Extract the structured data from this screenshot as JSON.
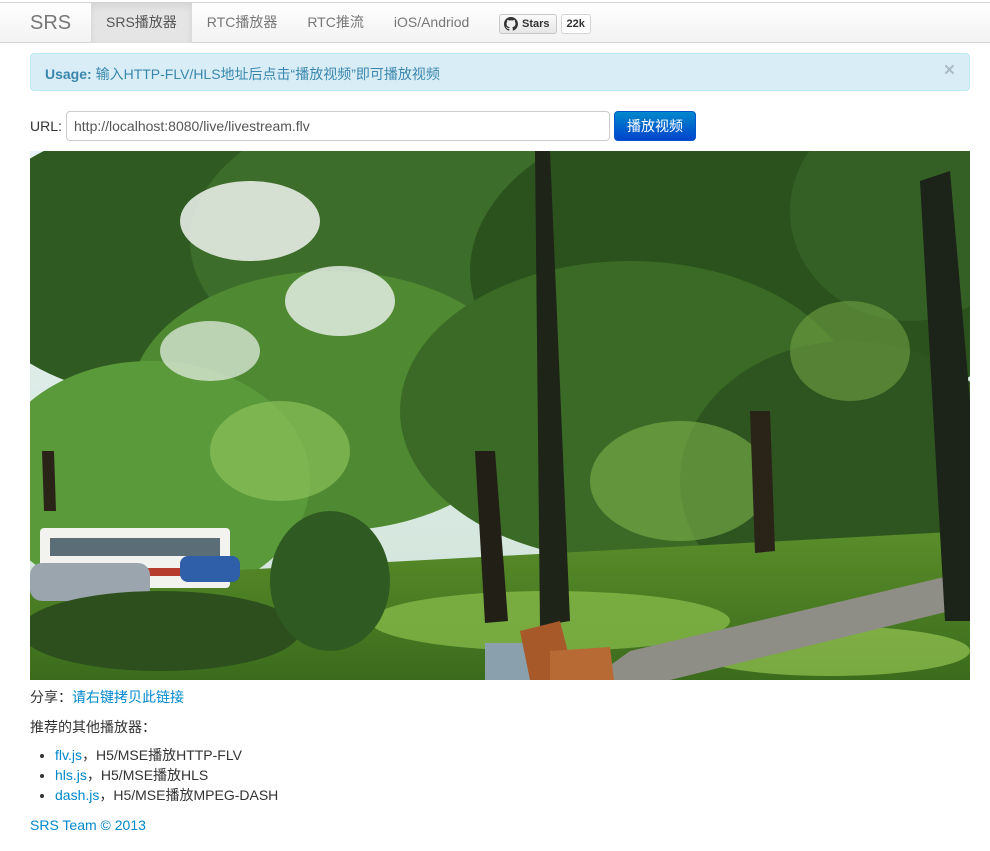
{
  "navbar": {
    "brand": "SRS",
    "items": [
      {
        "label": "SRS播放器",
        "active": true
      },
      {
        "label": "RTC播放器",
        "active": false
      },
      {
        "label": "RTC推流",
        "active": false
      },
      {
        "label": "iOS/Andriod",
        "active": false
      }
    ],
    "github": {
      "label": "Stars",
      "count": "22k",
      "icon": "github-icon"
    }
  },
  "alert": {
    "strong": "Usage:",
    "text": "输入HTTP-FLV/HLS地址后点击“播放视频”即可播放视频",
    "close": "×"
  },
  "player": {
    "url_label": "URL:",
    "url_value": "http://localhost:8080/live/livestream.flv",
    "play_label": "播放视频"
  },
  "share": {
    "label": "分享：",
    "link": "请右键拷贝此链接"
  },
  "recommend": {
    "title": "推荐的其他播放器：",
    "items": [
      {
        "name": "flv.js",
        "desc": "，H5/MSE播放HTTP-FLV"
      },
      {
        "name": "hls.js",
        "desc": "，H5/MSE播放HLS"
      },
      {
        "name": "dash.js",
        "desc": "，H5/MSE播放MPEG-DASH"
      }
    ]
  },
  "footer": "SRS Team © 2013",
  "colors": {
    "link": "#0088cc",
    "button": "#0066cc",
    "alert_bg": "#d9edf7",
    "alert_text": "#3a87ad"
  }
}
